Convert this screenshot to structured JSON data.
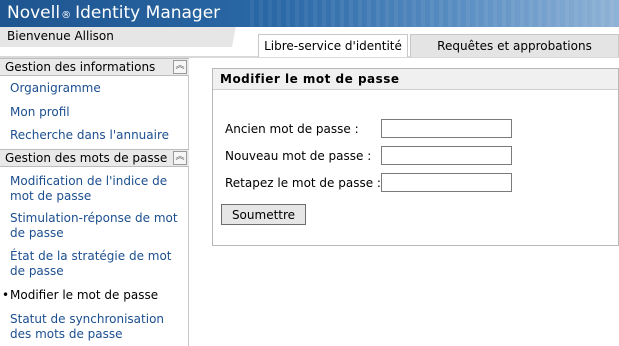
{
  "header": {
    "brand_name": "Novell",
    "brand_mark": "®",
    "product": "Identity Manager"
  },
  "welcome": "Bienvenue Allison",
  "tabs": [
    {
      "label": "Libre-service d'identité",
      "active": true
    },
    {
      "label": "Requêtes et approbations",
      "active": false
    }
  ],
  "sidebar": {
    "sections": [
      {
        "title": "Gestion des informations",
        "toggle_icon": "collapse-up-icon",
        "items": [
          {
            "label": "Organigramme"
          },
          {
            "label": "Mon profil"
          },
          {
            "label": "Recherche dans l'annuaire"
          }
        ]
      },
      {
        "title": "Gestion des mots de passe",
        "toggle_icon": "collapse-up-icon",
        "items": [
          {
            "label": "Modification de l'indice de mot de passe"
          },
          {
            "label": "Stimulation-réponse de mot de passe"
          },
          {
            "label": "État de la stratégie de mot de passe"
          },
          {
            "label": "Modifier le mot de passe",
            "current": true,
            "bullet": "•"
          },
          {
            "label": "Statut de synchronisation des mots de passe"
          }
        ]
      }
    ]
  },
  "panel": {
    "title": "Modifier le mot de passe",
    "fields": [
      {
        "label": "Ancien mot de passe :",
        "value": ""
      },
      {
        "label": "Nouveau mot de passe :",
        "value": ""
      },
      {
        "label": "Retapez le mot de passe :",
        "value": ""
      }
    ],
    "submit_label": "Soumettre"
  },
  "colors": {
    "header_blue": "#1e5590",
    "link": "#1c4f8f",
    "section_bg": "#e9e9e9"
  }
}
